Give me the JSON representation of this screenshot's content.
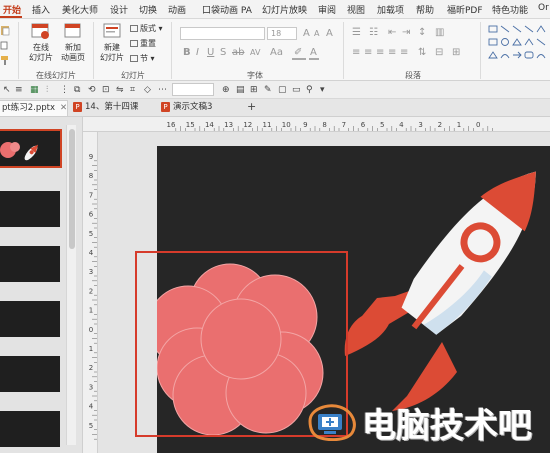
{
  "menu": {
    "tabs": [
      {
        "label": "开始",
        "active": true
      },
      {
        "label": "插入"
      },
      {
        "label": "美化大师"
      },
      {
        "label": "设计"
      },
      {
        "label": "切换"
      },
      {
        "label": "动画"
      },
      {
        "label": "口袋动画 PA"
      },
      {
        "label": "幻灯片放映"
      },
      {
        "label": "审阅"
      },
      {
        "label": "视图"
      },
      {
        "label": "加载项"
      },
      {
        "label": "帮助"
      },
      {
        "label": "福昕PDF"
      },
      {
        "label": "特色功能"
      },
      {
        "label": "Or"
      }
    ]
  },
  "ribbon": {
    "online_label_1": "在线",
    "online_label_2": "幻灯片",
    "new_animpage_label_1": "新加",
    "new_animpage_label_2": "动画页",
    "group_online": "在线幻灯片",
    "new_slide_label_1": "新建",
    "new_slide_label_2": "幻灯片",
    "layout_label": "版式",
    "reset_label": "重置",
    "section_label": "节",
    "group_slides": "幻灯片",
    "group_font": "字体",
    "group_paragraph": "段落",
    "font_size_value": "18"
  },
  "documents": [
    {
      "label": "pt练习2.pptx",
      "active": true
    },
    {
      "label": "14、第十四课"
    },
    {
      "label": "演示文稿3"
    }
  ],
  "ruler": {
    "h_marks": [
      "16",
      "15",
      "14",
      "13",
      "12",
      "11",
      "10",
      "9",
      "8",
      "7",
      "6",
      "5",
      "4",
      "3",
      "2",
      "1",
      "0"
    ],
    "v_marks": [
      "9",
      "8",
      "7",
      "6",
      "5",
      "4",
      "3",
      "2",
      "1",
      "0",
      "1",
      "2",
      "3",
      "4",
      "5"
    ]
  },
  "watermark": {
    "text": "电脑技术吧"
  },
  "colors": {
    "accent": "#c43e1c",
    "slide_bg": "#262626",
    "petal": "#ea6f6f",
    "petal_stroke": "#f3a5a5",
    "selection_box": "#d63b2b",
    "rocket_red": "#dc4b35",
    "rocket_white": "#f4f4f4"
  }
}
